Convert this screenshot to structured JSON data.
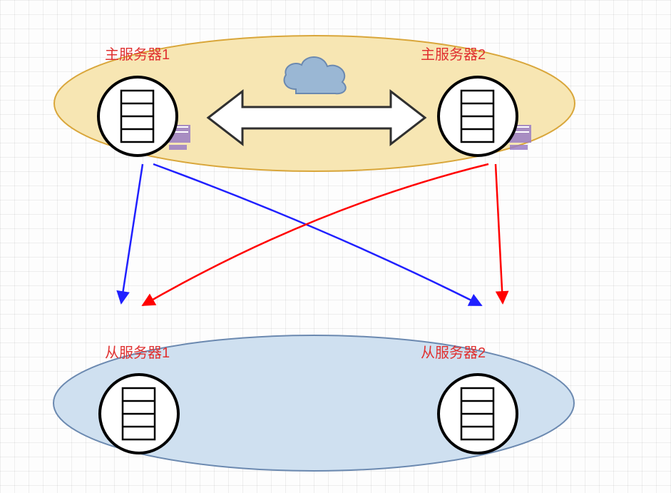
{
  "diagram": {
    "master_group": {
      "label_1": "主服务器1",
      "label_2": "主服务器2",
      "fill": "#f7e6b3",
      "stroke": "#d9a63a"
    },
    "slave_group": {
      "label_1": "从服务器1",
      "label_2": "从服务器2",
      "fill": "#cfe0f0",
      "stroke": "#6b89b0"
    },
    "connections": [
      {
        "from": "master1",
        "to": "slave1",
        "color": "#2020ff",
        "type": "straight"
      },
      {
        "from": "master1",
        "to": "slave2",
        "color": "#2020ff",
        "type": "curved"
      },
      {
        "from": "master2",
        "to": "slave2",
        "color": "#ff0000",
        "type": "straight"
      },
      {
        "from": "master2",
        "to": "slave1",
        "color": "#ff0000",
        "type": "curved"
      }
    ],
    "cloud_color": "#9ab7d4",
    "arrow_bidir_fill": "#ffffff",
    "arrow_bidir_stroke": "#303030",
    "server_stroke": "#000000",
    "accent_icon_color": "#8a6fb5"
  }
}
